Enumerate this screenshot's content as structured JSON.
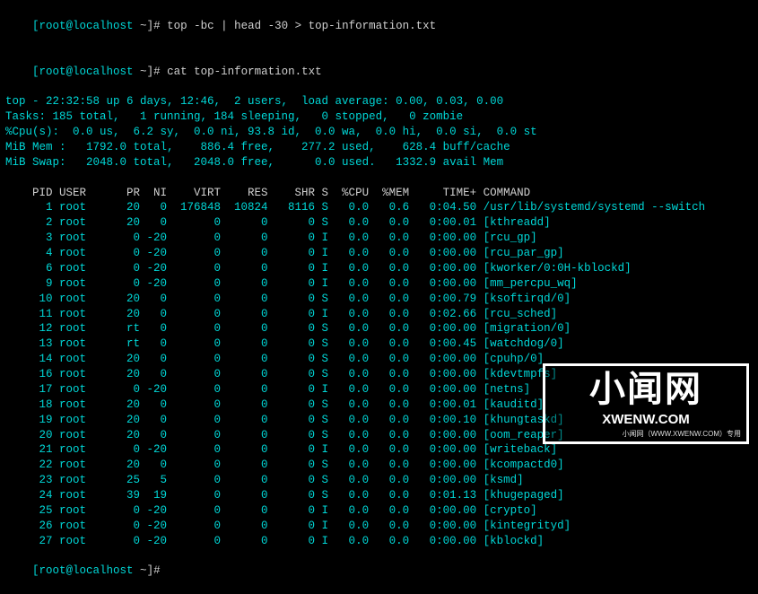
{
  "prompts": [
    {
      "user_host": "[root@localhost ",
      "tilde": "~",
      "close_cmd": "]# top -bc | head -30 > top-information.txt"
    },
    {
      "user_host": "[root@localhost ",
      "tilde": "~",
      "close_cmd": "]# cat top-information.txt"
    }
  ],
  "header": [
    "top - 22:32:58 up 6 days, 12:46,  2 users,  load average: 0.00, 0.03, 0.00",
    "Tasks: 185 total,   1 running, 184 sleeping,   0 stopped,   0 zombie",
    "%Cpu(s):  0.0 us,  6.2 sy,  0.0 ni, 93.8 id,  0.0 wa,  0.0 hi,  0.0 si,  0.0 st",
    "MiB Mem :   1792.0 total,    886.4 free,    277.2 used,    628.4 buff/cache",
    "MiB Swap:   2048.0 total,   2048.0 free,      0.0 used.   1332.9 avail Mem"
  ],
  "table": {
    "columns": "    PID USER      PR  NI    VIRT    RES    SHR S  %CPU  %MEM     TIME+ COMMAND",
    "rows": [
      {
        "pid": 1,
        "user": "root",
        "pr": "20",
        "ni": "0",
        "virt": "176848",
        "res": "10824",
        "shr": "8116",
        "s": "S",
        "cpu": "0.0",
        "mem": "0.6",
        "time": "0:04.50",
        "cmd": "/usr/lib/systemd/systemd --switch"
      },
      {
        "pid": 2,
        "user": "root",
        "pr": "20",
        "ni": "0",
        "virt": "0",
        "res": "0",
        "shr": "0",
        "s": "S",
        "cpu": "0.0",
        "mem": "0.0",
        "time": "0:00.01",
        "cmd": "[kthreadd]"
      },
      {
        "pid": 3,
        "user": "root",
        "pr": "0",
        "ni": "-20",
        "virt": "0",
        "res": "0",
        "shr": "0",
        "s": "I",
        "cpu": "0.0",
        "mem": "0.0",
        "time": "0:00.00",
        "cmd": "[rcu_gp]"
      },
      {
        "pid": 4,
        "user": "root",
        "pr": "0",
        "ni": "-20",
        "virt": "0",
        "res": "0",
        "shr": "0",
        "s": "I",
        "cpu": "0.0",
        "mem": "0.0",
        "time": "0:00.00",
        "cmd": "[rcu_par_gp]"
      },
      {
        "pid": 6,
        "user": "root",
        "pr": "0",
        "ni": "-20",
        "virt": "0",
        "res": "0",
        "shr": "0",
        "s": "I",
        "cpu": "0.0",
        "mem": "0.0",
        "time": "0:00.00",
        "cmd": "[kworker/0:0H-kblockd]"
      },
      {
        "pid": 9,
        "user": "root",
        "pr": "0",
        "ni": "-20",
        "virt": "0",
        "res": "0",
        "shr": "0",
        "s": "I",
        "cpu": "0.0",
        "mem": "0.0",
        "time": "0:00.00",
        "cmd": "[mm_percpu_wq]"
      },
      {
        "pid": 10,
        "user": "root",
        "pr": "20",
        "ni": "0",
        "virt": "0",
        "res": "0",
        "shr": "0",
        "s": "S",
        "cpu": "0.0",
        "mem": "0.0",
        "time": "0:00.79",
        "cmd": "[ksoftirqd/0]"
      },
      {
        "pid": 11,
        "user": "root",
        "pr": "20",
        "ni": "0",
        "virt": "0",
        "res": "0",
        "shr": "0",
        "s": "I",
        "cpu": "0.0",
        "mem": "0.0",
        "time": "0:02.66",
        "cmd": "[rcu_sched]"
      },
      {
        "pid": 12,
        "user": "root",
        "pr": "rt",
        "ni": "0",
        "virt": "0",
        "res": "0",
        "shr": "0",
        "s": "S",
        "cpu": "0.0",
        "mem": "0.0",
        "time": "0:00.00",
        "cmd": "[migration/0]"
      },
      {
        "pid": 13,
        "user": "root",
        "pr": "rt",
        "ni": "0",
        "virt": "0",
        "res": "0",
        "shr": "0",
        "s": "S",
        "cpu": "0.0",
        "mem": "0.0",
        "time": "0:00.45",
        "cmd": "[watchdog/0]"
      },
      {
        "pid": 14,
        "user": "root",
        "pr": "20",
        "ni": "0",
        "virt": "0",
        "res": "0",
        "shr": "0",
        "s": "S",
        "cpu": "0.0",
        "mem": "0.0",
        "time": "0:00.00",
        "cmd": "[cpuhp/0]"
      },
      {
        "pid": 16,
        "user": "root",
        "pr": "20",
        "ni": "0",
        "virt": "0",
        "res": "0",
        "shr": "0",
        "s": "S",
        "cpu": "0.0",
        "mem": "0.0",
        "time": "0:00.00",
        "cmd": "[kdevtmpfs]"
      },
      {
        "pid": 17,
        "user": "root",
        "pr": "0",
        "ni": "-20",
        "virt": "0",
        "res": "0",
        "shr": "0",
        "s": "I",
        "cpu": "0.0",
        "mem": "0.0",
        "time": "0:00.00",
        "cmd": "[netns]"
      },
      {
        "pid": 18,
        "user": "root",
        "pr": "20",
        "ni": "0",
        "virt": "0",
        "res": "0",
        "shr": "0",
        "s": "S",
        "cpu": "0.0",
        "mem": "0.0",
        "time": "0:00.01",
        "cmd": "[kauditd]"
      },
      {
        "pid": 19,
        "user": "root",
        "pr": "20",
        "ni": "0",
        "virt": "0",
        "res": "0",
        "shr": "0",
        "s": "S",
        "cpu": "0.0",
        "mem": "0.0",
        "time": "0:00.10",
        "cmd": "[khungtaskd]"
      },
      {
        "pid": 20,
        "user": "root",
        "pr": "20",
        "ni": "0",
        "virt": "0",
        "res": "0",
        "shr": "0",
        "s": "S",
        "cpu": "0.0",
        "mem": "0.0",
        "time": "0:00.00",
        "cmd": "[oom_reaper]"
      },
      {
        "pid": 21,
        "user": "root",
        "pr": "0",
        "ni": "-20",
        "virt": "0",
        "res": "0",
        "shr": "0",
        "s": "I",
        "cpu": "0.0",
        "mem": "0.0",
        "time": "0:00.00",
        "cmd": "[writeback]"
      },
      {
        "pid": 22,
        "user": "root",
        "pr": "20",
        "ni": "0",
        "virt": "0",
        "res": "0",
        "shr": "0",
        "s": "S",
        "cpu": "0.0",
        "mem": "0.0",
        "time": "0:00.00",
        "cmd": "[kcompactd0]"
      },
      {
        "pid": 23,
        "user": "root",
        "pr": "25",
        "ni": "5",
        "virt": "0",
        "res": "0",
        "shr": "0",
        "s": "S",
        "cpu": "0.0",
        "mem": "0.0",
        "time": "0:00.00",
        "cmd": "[ksmd]"
      },
      {
        "pid": 24,
        "user": "root",
        "pr": "39",
        "ni": "19",
        "virt": "0",
        "res": "0",
        "shr": "0",
        "s": "S",
        "cpu": "0.0",
        "mem": "0.0",
        "time": "0:01.13",
        "cmd": "[khugepaged]"
      },
      {
        "pid": 25,
        "user": "root",
        "pr": "0",
        "ni": "-20",
        "virt": "0",
        "res": "0",
        "shr": "0",
        "s": "I",
        "cpu": "0.0",
        "mem": "0.0",
        "time": "0:00.00",
        "cmd": "[crypto]"
      },
      {
        "pid": 26,
        "user": "root",
        "pr": "0",
        "ni": "-20",
        "virt": "0",
        "res": "0",
        "shr": "0",
        "s": "I",
        "cpu": "0.0",
        "mem": "0.0",
        "time": "0:00.00",
        "cmd": "[kintegrityd]"
      },
      {
        "pid": 27,
        "user": "root",
        "pr": "0",
        "ni": "-20",
        "virt": "0",
        "res": "0",
        "shr": "0",
        "s": "I",
        "cpu": "0.0",
        "mem": "0.0",
        "time": "0:00.00",
        "cmd": "[kblockd]"
      }
    ]
  },
  "final_prompt": {
    "user_host": "[root@localhost ",
    "tilde": "~",
    "close_cmd": "]# "
  },
  "watermark": {
    "big": "小闻网",
    "site": "XWENW.COM",
    "tiny": "小闻网（WWW.XWENW.COM）专用"
  }
}
